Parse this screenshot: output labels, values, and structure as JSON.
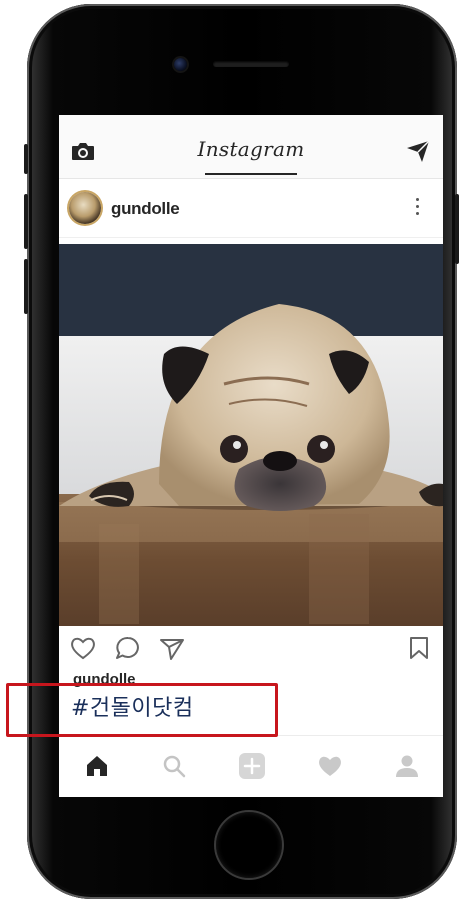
{
  "app": {
    "title": "Instagram"
  },
  "post": {
    "username": "gundolle",
    "caption_username": "gundolle",
    "hashtag": "#건돌이닷컴",
    "image": "pug-lying-on-wooden-floor"
  },
  "icons": {
    "topbar_left": "camera-icon",
    "topbar_right": "send-icon",
    "post_more": "more-vertical-icon",
    "actions": [
      "heart-icon",
      "comment-icon",
      "share-icon",
      "bookmark-icon"
    ],
    "tabs": [
      "home-icon",
      "search-icon",
      "add-icon",
      "activity-heart-icon",
      "profile-icon"
    ]
  },
  "colors": {
    "highlight": "#c7161d",
    "hashtag": "#1a2f5a",
    "text": "#262626"
  }
}
